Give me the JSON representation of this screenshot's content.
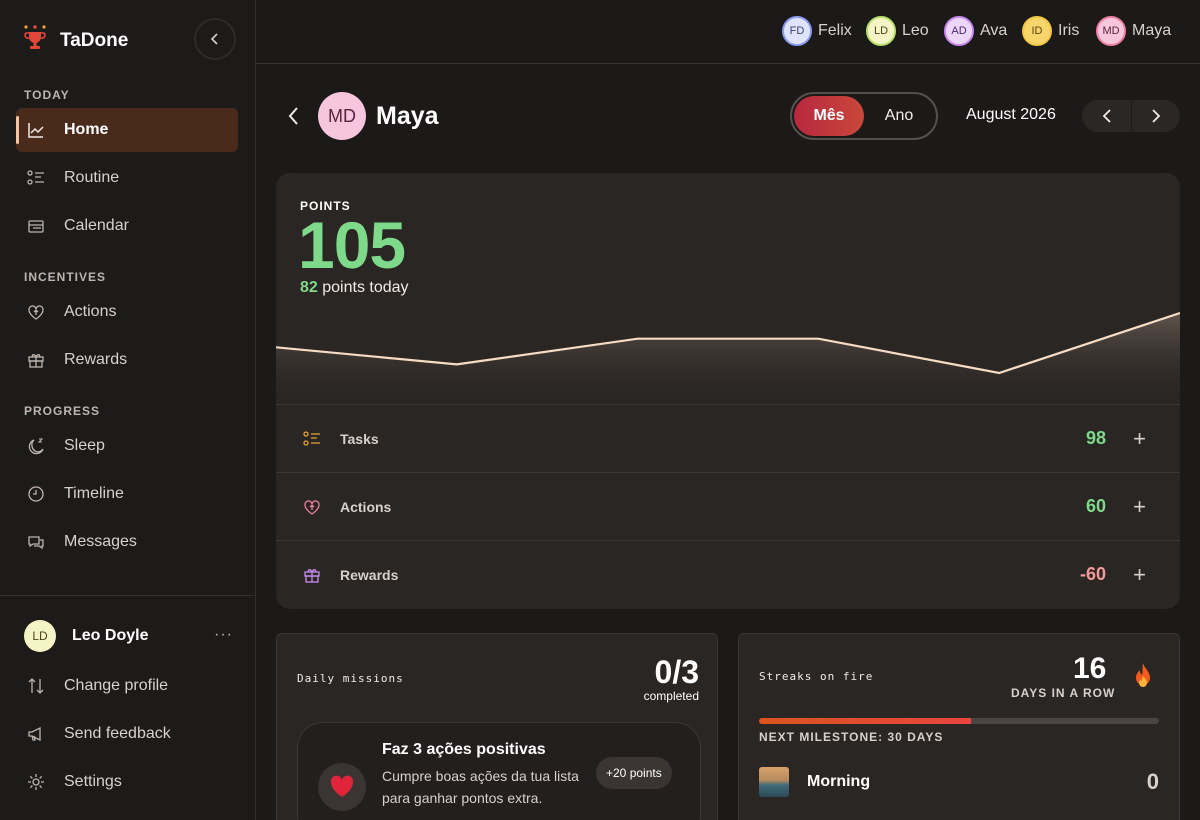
{
  "app": {
    "name": "TaDone"
  },
  "sidebar": {
    "sections": {
      "today": "TODAY",
      "incentives": "INCENTIVES",
      "progress": "PROGRESS"
    },
    "items": [
      {
        "label": "Home",
        "icon": "chart-line-icon",
        "active": true
      },
      {
        "label": "Routine",
        "icon": "list-icon"
      },
      {
        "label": "Calendar",
        "icon": "calendar-icon"
      },
      {
        "label": "Actions",
        "icon": "heart-icon"
      },
      {
        "label": "Rewards",
        "icon": "gift-icon"
      },
      {
        "label": "Sleep",
        "icon": "moon-icon"
      },
      {
        "label": "Timeline",
        "icon": "clock-icon"
      },
      {
        "label": "Messages",
        "icon": "chat-icon"
      }
    ],
    "user": {
      "initials": "LD",
      "name": "Leo Doyle",
      "more": "···"
    },
    "footer": [
      {
        "label": "Change profile",
        "icon": "swap-icon"
      },
      {
        "label": "Send feedback",
        "icon": "megaphone-icon"
      },
      {
        "label": "Settings",
        "icon": "gear-icon"
      }
    ]
  },
  "members": [
    {
      "initials": "FD",
      "name": "Felix",
      "color": "#8c9bf0",
      "bg": "#e0e4fb"
    },
    {
      "initials": "LD",
      "name": "Leo",
      "color": "#b7e06a",
      "bg": "#f5f4c6"
    },
    {
      "initials": "AD",
      "name": "Ava",
      "color": "#c78bf0",
      "bg": "#ecd6fa"
    },
    {
      "initials": "ID",
      "name": "Iris",
      "color": "#f2c744",
      "bg": "#f8d56a"
    },
    {
      "initials": "MD",
      "name": "Maya",
      "color": "#ee7f9e",
      "bg": "#f6c6de"
    }
  ],
  "profile": {
    "initials": "MD",
    "name": "Maya"
  },
  "period": {
    "month": "Mês",
    "year": "Ano",
    "current": "August 2026"
  },
  "points": {
    "label": "POINTS",
    "total": "105",
    "today_value": "82",
    "today_text": "points today",
    "sparkline": [
      105,
      101,
      107,
      107,
      99,
      113
    ],
    "rows": [
      {
        "label": "Tasks",
        "value": "98",
        "color": "#7ed98a",
        "icon": "list-icon"
      },
      {
        "label": "Actions",
        "value": "60",
        "color": "#7ed98a",
        "icon": "heart-icon"
      },
      {
        "label": "Rewards",
        "value": "-60",
        "color": "#f39a9a",
        "icon": "gift-icon"
      }
    ],
    "plus": "+"
  },
  "missions": {
    "title": "Daily missions",
    "count": "0/3",
    "sub": "completed",
    "item": {
      "title": "Faz 3 ações positivas",
      "desc": "Cumpre boas ações da tua lista para ganhar pontos extra.",
      "badge": "+20 points"
    }
  },
  "streaks": {
    "title": "Streaks on fire",
    "count": "16",
    "sub": "DAYS IN A ROW",
    "progress": 0.53,
    "milestone": "NEXT MILESTONE: 30 DAYS",
    "routine": {
      "name": "Morning",
      "value": "0"
    }
  }
}
